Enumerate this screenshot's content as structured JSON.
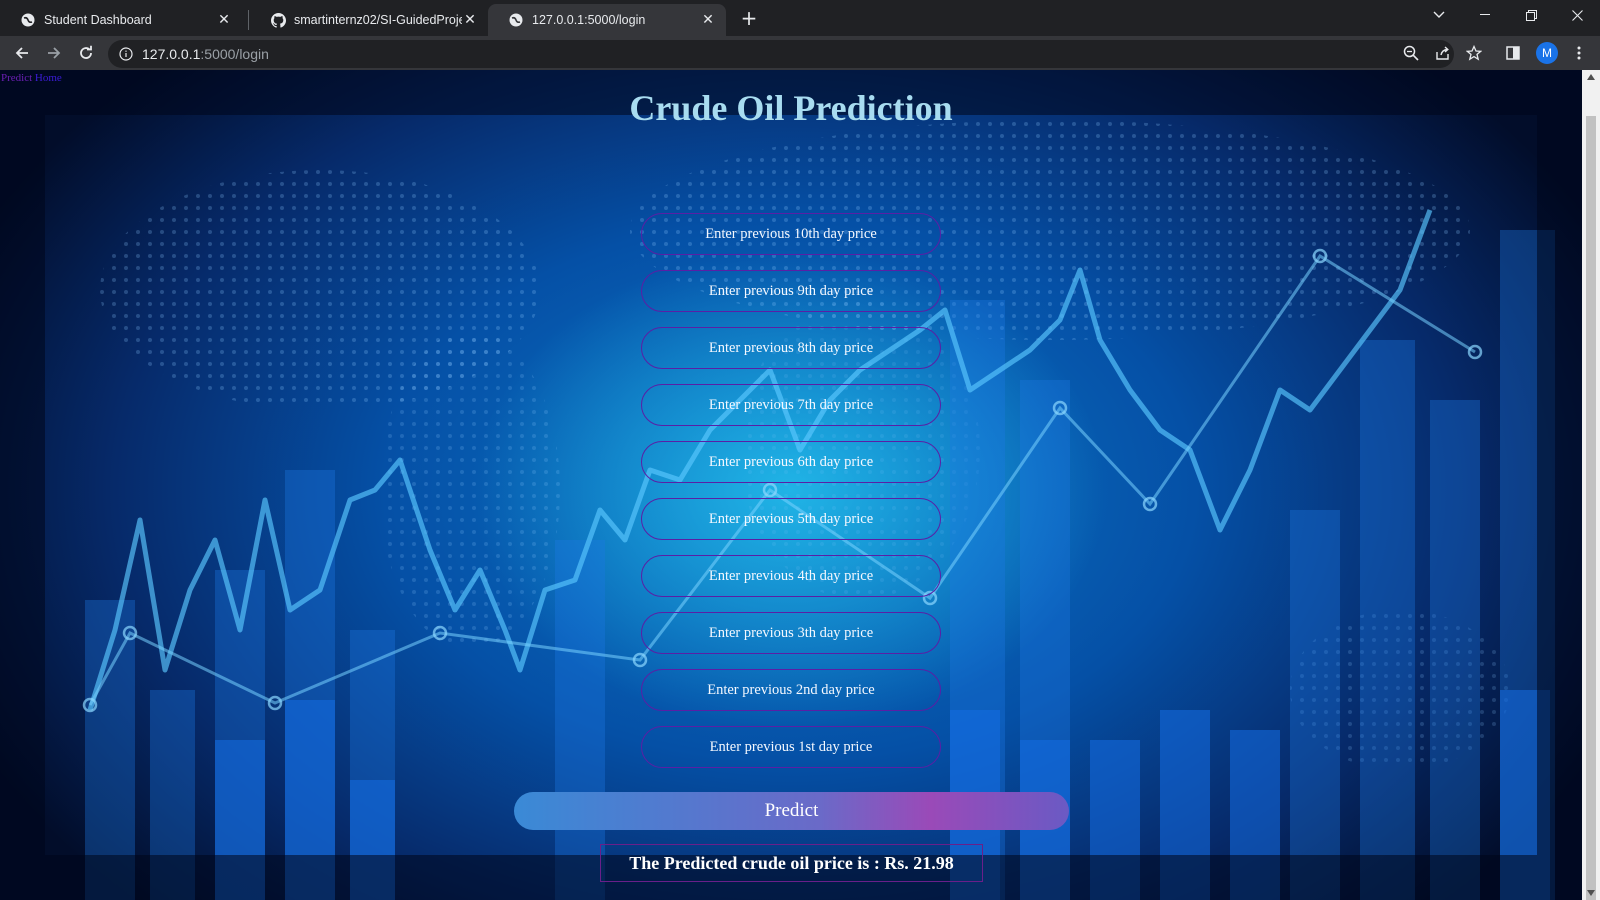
{
  "browser": {
    "tabs": [
      {
        "title": "Student Dashboard",
        "favicon": "globe-icon"
      },
      {
        "title": "smartinternz02/SI-GuidedProject",
        "favicon": "github-icon"
      },
      {
        "title": "127.0.0.1:5000/login",
        "favicon": "globe-icon",
        "active": true
      }
    ],
    "address": {
      "host": "127.0.0.1",
      "path": ":5000/login"
    },
    "profile_initial": "M"
  },
  "page": {
    "nav": {
      "predict": "Predict",
      "home": "Home"
    },
    "title": "Crude Oil Prediction",
    "fields": [
      {
        "placeholder": "Enter previous 10th day price"
      },
      {
        "placeholder": "Enter previous 9th day price"
      },
      {
        "placeholder": "Enter previous 8th day price"
      },
      {
        "placeholder": "Enter previous 7th day price"
      },
      {
        "placeholder": "Enter previous 6th day price"
      },
      {
        "placeholder": "Enter previous 5th day price"
      },
      {
        "placeholder": "Enter previous 4th day price"
      },
      {
        "placeholder": "Enter previous 3th day price"
      },
      {
        "placeholder": "Enter previous 2nd day price"
      },
      {
        "placeholder": "Enter previous 1st day price"
      }
    ],
    "predict_label": "Predict",
    "result_text": "The Predicted crude oil price is : Rs. 21.98"
  },
  "colors": {
    "heading": "#a8dcf0",
    "field_border": "#5a1fa6",
    "result_border": "#6a1f8a"
  }
}
